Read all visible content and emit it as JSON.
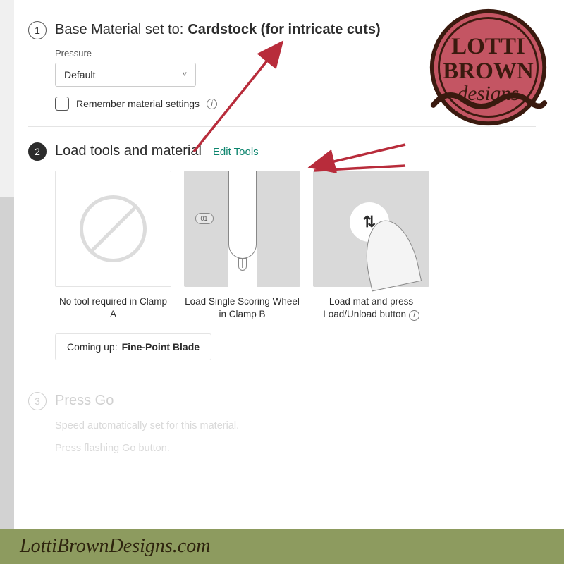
{
  "step1": {
    "num": "1",
    "title_prefix": "Base Material set to:",
    "material": "Cardstock (for intricate cuts)",
    "pressure_label": "Pressure",
    "pressure_value": "Default",
    "remember_label": "Remember material settings"
  },
  "step2": {
    "num": "2",
    "title": "Load tools and material",
    "edit_tools": "Edit Tools",
    "cards": [
      {
        "caption": "No tool required in Clamp A"
      },
      {
        "caption": "Load Single Scoring Wheel in Clamp B",
        "badge": "01"
      },
      {
        "caption": "Load mat and press Load/Unload button"
      }
    ],
    "coming_up_prefix": "Coming up:",
    "coming_up_value": "Fine-Point Blade"
  },
  "step3": {
    "num": "3",
    "title": "Press Go",
    "line1": "Speed automatically set for this material.",
    "line2": "Press flashing Go button."
  },
  "logo": {
    "line1": "LOTTI",
    "line2": "BROWN",
    "line3": "designs"
  },
  "website": "LottiBrownDesigns.com",
  "colors": {
    "arrow": "#b82c3b",
    "badge_fill": "#c45563",
    "badge_stroke": "#3a1a0f"
  }
}
